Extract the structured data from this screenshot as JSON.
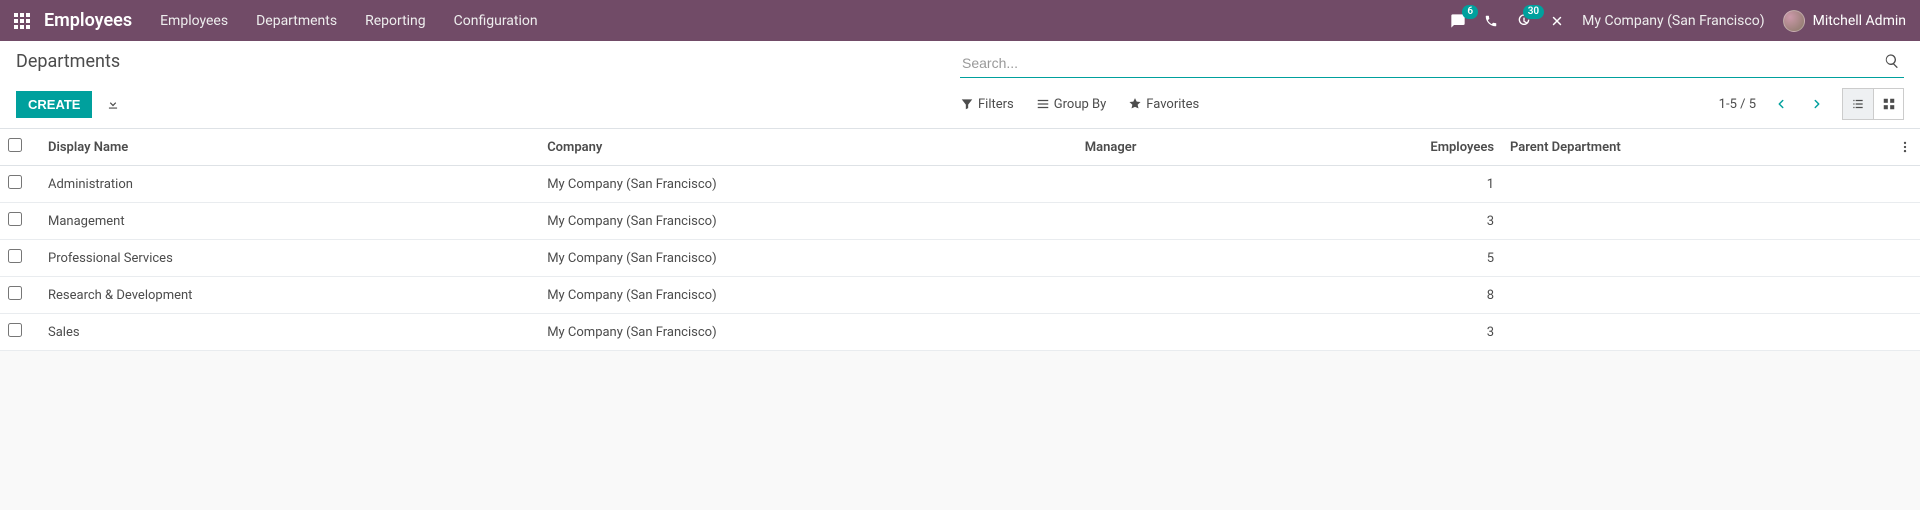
{
  "navbar": {
    "brand": "Employees",
    "links": [
      "Employees",
      "Departments",
      "Reporting",
      "Configuration"
    ],
    "messages_badge": "6",
    "activities_badge": "30",
    "company": "My Company (San Francisco)",
    "user_name": "Mitchell Admin"
  },
  "control_panel": {
    "title": "Departments",
    "search_placeholder": "Search...",
    "create_label": "Create",
    "filters_label": "Filters",
    "groupby_label": "Group By",
    "favorites_label": "Favorites",
    "pager": "1-5 / 5"
  },
  "table": {
    "headers": {
      "display_name": "Display Name",
      "company": "Company",
      "manager": "Manager",
      "employees": "Employees",
      "parent": "Parent Department"
    },
    "rows": [
      {
        "display_name": "Administration",
        "company": "My Company (San Francisco)",
        "manager": "",
        "employees": "1",
        "parent": ""
      },
      {
        "display_name": "Management",
        "company": "My Company (San Francisco)",
        "manager": "",
        "employees": "3",
        "parent": ""
      },
      {
        "display_name": "Professional Services",
        "company": "My Company (San Francisco)",
        "manager": "",
        "employees": "5",
        "parent": ""
      },
      {
        "display_name": "Research & Development",
        "company": "My Company (San Francisco)",
        "manager": "",
        "employees": "8",
        "parent": ""
      },
      {
        "display_name": "Sales",
        "company": "My Company (San Francisco)",
        "manager": "",
        "employees": "3",
        "parent": ""
      }
    ]
  }
}
